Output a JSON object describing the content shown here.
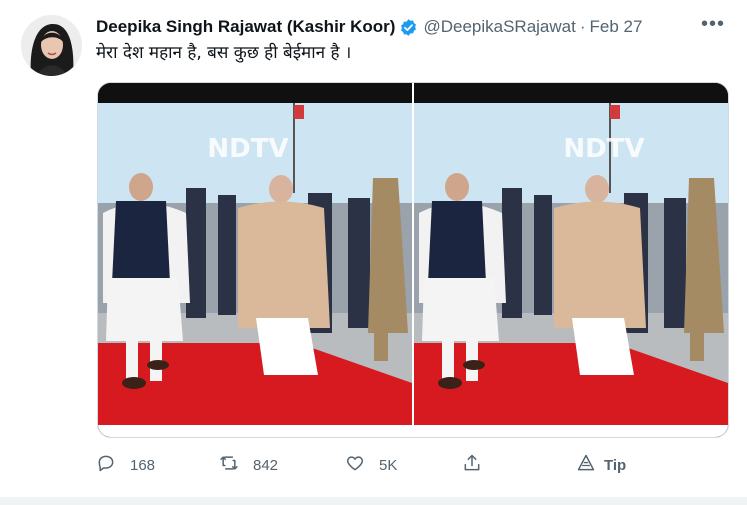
{
  "tweet": {
    "author_name": "Deepika Singh Rajawat (Kashir Koor)",
    "handle": "@DeepikaSRajawat",
    "separator": "·",
    "date": "Feb 27",
    "text": "मेरा देश महान है, बस कुछ ही बेईमान है ।",
    "verified": true
  },
  "media": {
    "watermark": "NDTV",
    "panels": 2
  },
  "actions": {
    "reply_count": "168",
    "retweet_count": "842",
    "like_count": "5K",
    "share_label": "",
    "tip_label": "Tip"
  },
  "colors": {
    "verified": "#1d9bf0",
    "text_secondary": "#536471",
    "carpet": "#d61a1f"
  },
  "icons": [
    "verified-badge-icon",
    "more-icon",
    "reply-icon",
    "retweet-icon",
    "like-icon",
    "share-icon",
    "tip-icon"
  ]
}
